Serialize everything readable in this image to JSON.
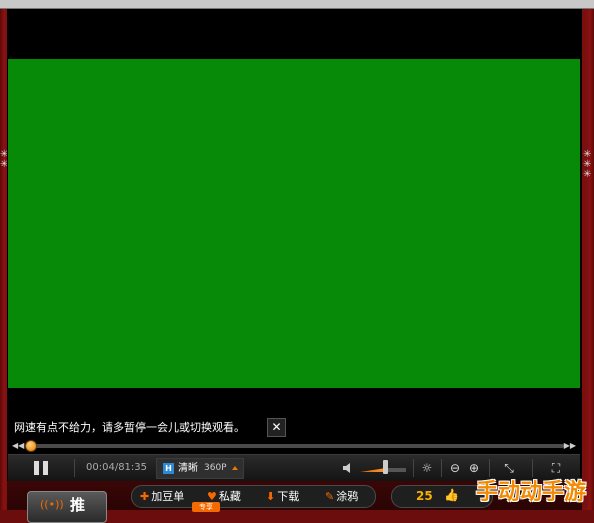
{
  "notice": {
    "text": "网速有点不给力，请多暂停一会儿或切换观看。",
    "close": "✕"
  },
  "player": {
    "seek_progress": 0.01,
    "time": "00:04/81:35",
    "quality": {
      "badge": "H",
      "label": "清晰",
      "resolution": "360P"
    },
    "volume_level": 0.55
  },
  "actions": [
    {
      "icon": "plus-icon",
      "glyph": "✚",
      "label": "加豆单"
    },
    {
      "icon": "heart-icon",
      "glyph": "♥",
      "label": "私藏"
    },
    {
      "icon": "download-icon",
      "glyph": "⬇",
      "label": "下载"
    },
    {
      "icon": "brush-icon",
      "glyph": "✎",
      "label": "涂鸦"
    }
  ],
  "action_tag": "专享",
  "like": {
    "count": "25",
    "icon": "thumbs-up-icon"
  },
  "push_button": {
    "label": "推"
  },
  "watermark": "手动动手游",
  "colors": {
    "video": "#068a08",
    "accent": "#f46a00",
    "frame": "#7a0f0f"
  }
}
